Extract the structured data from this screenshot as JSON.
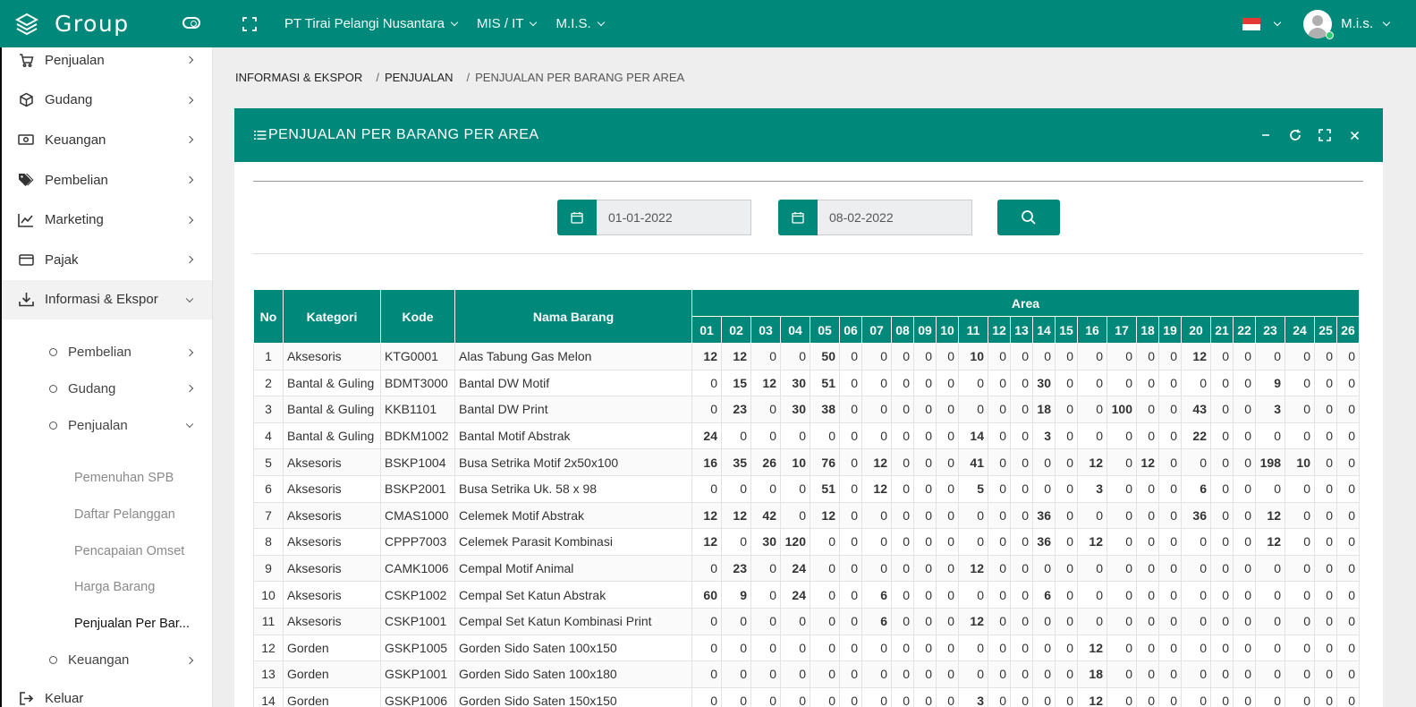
{
  "topbar": {
    "brand": "Group",
    "company": "PT Tirai Pelangi Nusantara",
    "division": "MIS / IT",
    "department": "M.I.S.",
    "username": "M.i.s."
  },
  "sidebar": {
    "items": [
      {
        "label": "Penjualan",
        "icon": "cart-icon"
      },
      {
        "label": "Gudang",
        "icon": "box-icon"
      },
      {
        "label": "Keuangan",
        "icon": "money-icon"
      },
      {
        "label": "Pembelian",
        "icon": "tags-icon"
      },
      {
        "label": "Marketing",
        "icon": "chart-line-icon"
      },
      {
        "label": "Pajak",
        "icon": "credit-card-icon"
      },
      {
        "label": "Informasi & Ekspor",
        "icon": "download-icon"
      }
    ],
    "sub_items": [
      {
        "label": "Pembelian"
      },
      {
        "label": "Gudang"
      },
      {
        "label": "Penjualan"
      }
    ],
    "leaves": [
      {
        "label": "Pemenuhan SPB"
      },
      {
        "label": "Daftar Pelanggan"
      },
      {
        "label": "Pencapaian Omset"
      },
      {
        "label": "Harga Barang"
      },
      {
        "label": "Penjualan Per Bar..."
      }
    ],
    "sub_last": {
      "label": "Keuangan"
    },
    "logout": "Keluar"
  },
  "breadcrumb": {
    "first": "INFORMASI & EKSPOR",
    "second": "PENJUALAN",
    "current": "PENJUALAN PER BARANG PER AREA"
  },
  "panel": {
    "title": "PENJUALAN PER BARANG PER AREA",
    "date_from": "01-01-2022",
    "date_to": "08-02-2022"
  },
  "table": {
    "headers": {
      "no": "No",
      "kategori": "Kategori",
      "kode": "Kode",
      "nama": "Nama Barang",
      "area": "Area"
    },
    "areas": [
      "01",
      "02",
      "03",
      "04",
      "05",
      "06",
      "07",
      "08",
      "09",
      "10",
      "11",
      "12",
      "13",
      "14",
      "15",
      "16",
      "17",
      "18",
      "19",
      "20",
      "21",
      "22",
      "23",
      "24",
      "25",
      "26"
    ],
    "rows": [
      {
        "no": "1",
        "kategori": "Aksesoris",
        "kode": "KTG0001",
        "nama": "Alas Tabung Gas Melon",
        "v": [
          12,
          12,
          0,
          0,
          50,
          0,
          0,
          0,
          0,
          0,
          10,
          0,
          0,
          0,
          0,
          0,
          0,
          0,
          0,
          12,
          0,
          0,
          0,
          0,
          0,
          0
        ]
      },
      {
        "no": "2",
        "kategori": "Bantal & Guling",
        "kode": "BDMT3000",
        "nama": "Bantal DW Motif",
        "v": [
          0,
          15,
          12,
          30,
          51,
          0,
          0,
          0,
          0,
          0,
          0,
          0,
          0,
          30,
          0,
          0,
          0,
          0,
          0,
          0,
          0,
          0,
          9,
          0,
          0,
          0
        ]
      },
      {
        "no": "3",
        "kategori": "Bantal & Guling",
        "kode": "KKB1101",
        "nama": "Bantal DW Print",
        "v": [
          0,
          23,
          0,
          30,
          38,
          0,
          0,
          0,
          0,
          0,
          0,
          0,
          0,
          18,
          0,
          0,
          100,
          0,
          0,
          43,
          0,
          0,
          3,
          0,
          0,
          0
        ]
      },
      {
        "no": "4",
        "kategori": "Bantal & Guling",
        "kode": "BDKM1002",
        "nama": "Bantal Motif Abstrak",
        "v": [
          24,
          0,
          0,
          0,
          0,
          0,
          0,
          0,
          0,
          0,
          14,
          0,
          0,
          3,
          0,
          0,
          0,
          0,
          0,
          22,
          0,
          0,
          0,
          0,
          0,
          0
        ]
      },
      {
        "no": "5",
        "kategori": "Aksesoris",
        "kode": "BSKP1004",
        "nama": "Busa Setrika Motif 2x50x100",
        "v": [
          16,
          35,
          26,
          10,
          76,
          0,
          12,
          0,
          0,
          0,
          41,
          0,
          0,
          0,
          0,
          12,
          0,
          12,
          0,
          0,
          0,
          0,
          198,
          10,
          0,
          0
        ]
      },
      {
        "no": "6",
        "kategori": "Aksesoris",
        "kode": "BSKP2001",
        "nama": "Busa Setrika Uk. 58 x 98",
        "v": [
          0,
          0,
          0,
          0,
          51,
          0,
          12,
          0,
          0,
          0,
          5,
          0,
          0,
          0,
          0,
          3,
          0,
          0,
          0,
          6,
          0,
          0,
          0,
          0,
          0,
          0
        ]
      },
      {
        "no": "7",
        "kategori": "Aksesoris",
        "kode": "CMAS1000",
        "nama": "Celemek Motif Abstrak",
        "v": [
          12,
          12,
          42,
          0,
          12,
          0,
          0,
          0,
          0,
          0,
          0,
          0,
          0,
          36,
          0,
          0,
          0,
          0,
          0,
          36,
          0,
          0,
          12,
          0,
          0,
          0
        ]
      },
      {
        "no": "8",
        "kategori": "Aksesoris",
        "kode": "CPPP7003",
        "nama": "Celemek Parasit Kombinasi",
        "v": [
          12,
          0,
          30,
          120,
          0,
          0,
          0,
          0,
          0,
          0,
          0,
          0,
          0,
          36,
          0,
          12,
          0,
          0,
          0,
          0,
          0,
          0,
          12,
          0,
          0,
          0
        ]
      },
      {
        "no": "9",
        "kategori": "Aksesoris",
        "kode": "CAMK1006",
        "nama": "Cempal Motif Animal",
        "v": [
          0,
          23,
          0,
          24,
          0,
          0,
          0,
          0,
          0,
          0,
          12,
          0,
          0,
          0,
          0,
          0,
          0,
          0,
          0,
          0,
          0,
          0,
          0,
          0,
          0,
          0
        ]
      },
      {
        "no": "10",
        "kategori": "Aksesoris",
        "kode": "CSKP1002",
        "nama": "Cempal Set Katun Abstrak",
        "v": [
          60,
          9,
          0,
          24,
          0,
          0,
          6,
          0,
          0,
          0,
          0,
          0,
          0,
          6,
          0,
          0,
          0,
          0,
          0,
          0,
          0,
          0,
          0,
          0,
          0,
          0
        ]
      },
      {
        "no": "11",
        "kategori": "Aksesoris",
        "kode": "CSKP1001",
        "nama": "Cempal Set Katun Kombinasi Print",
        "v": [
          0,
          0,
          0,
          0,
          0,
          0,
          6,
          0,
          0,
          0,
          12,
          0,
          0,
          0,
          0,
          0,
          0,
          0,
          0,
          0,
          0,
          0,
          0,
          0,
          0,
          0
        ]
      },
      {
        "no": "12",
        "kategori": "Gorden",
        "kode": "GSKP1005",
        "nama": "Gorden Sido Saten 100x150",
        "v": [
          0,
          0,
          0,
          0,
          0,
          0,
          0,
          0,
          0,
          0,
          0,
          0,
          0,
          0,
          0,
          12,
          0,
          0,
          0,
          0,
          0,
          0,
          0,
          0,
          0,
          0
        ]
      },
      {
        "no": "13",
        "kategori": "Gorden",
        "kode": "GSKP1001",
        "nama": "Gorden Sido Saten 100x180",
        "v": [
          0,
          0,
          0,
          0,
          0,
          0,
          0,
          0,
          0,
          0,
          0,
          0,
          0,
          0,
          0,
          18,
          0,
          0,
          0,
          0,
          0,
          0,
          0,
          0,
          0,
          0
        ]
      },
      {
        "no": "14",
        "kategori": "Gorden",
        "kode": "GSKP1006",
        "nama": "Gorden Sido Saten 150x150",
        "v": [
          0,
          0,
          0,
          0,
          0,
          0,
          0,
          0,
          0,
          0,
          3,
          0,
          0,
          0,
          0,
          12,
          0,
          0,
          0,
          0,
          0,
          0,
          0,
          0,
          0,
          0
        ]
      }
    ]
  },
  "colors": {
    "primary": "#00897b",
    "sidebar_bg": "#ffffff",
    "content_bg": "#eeeeee"
  }
}
